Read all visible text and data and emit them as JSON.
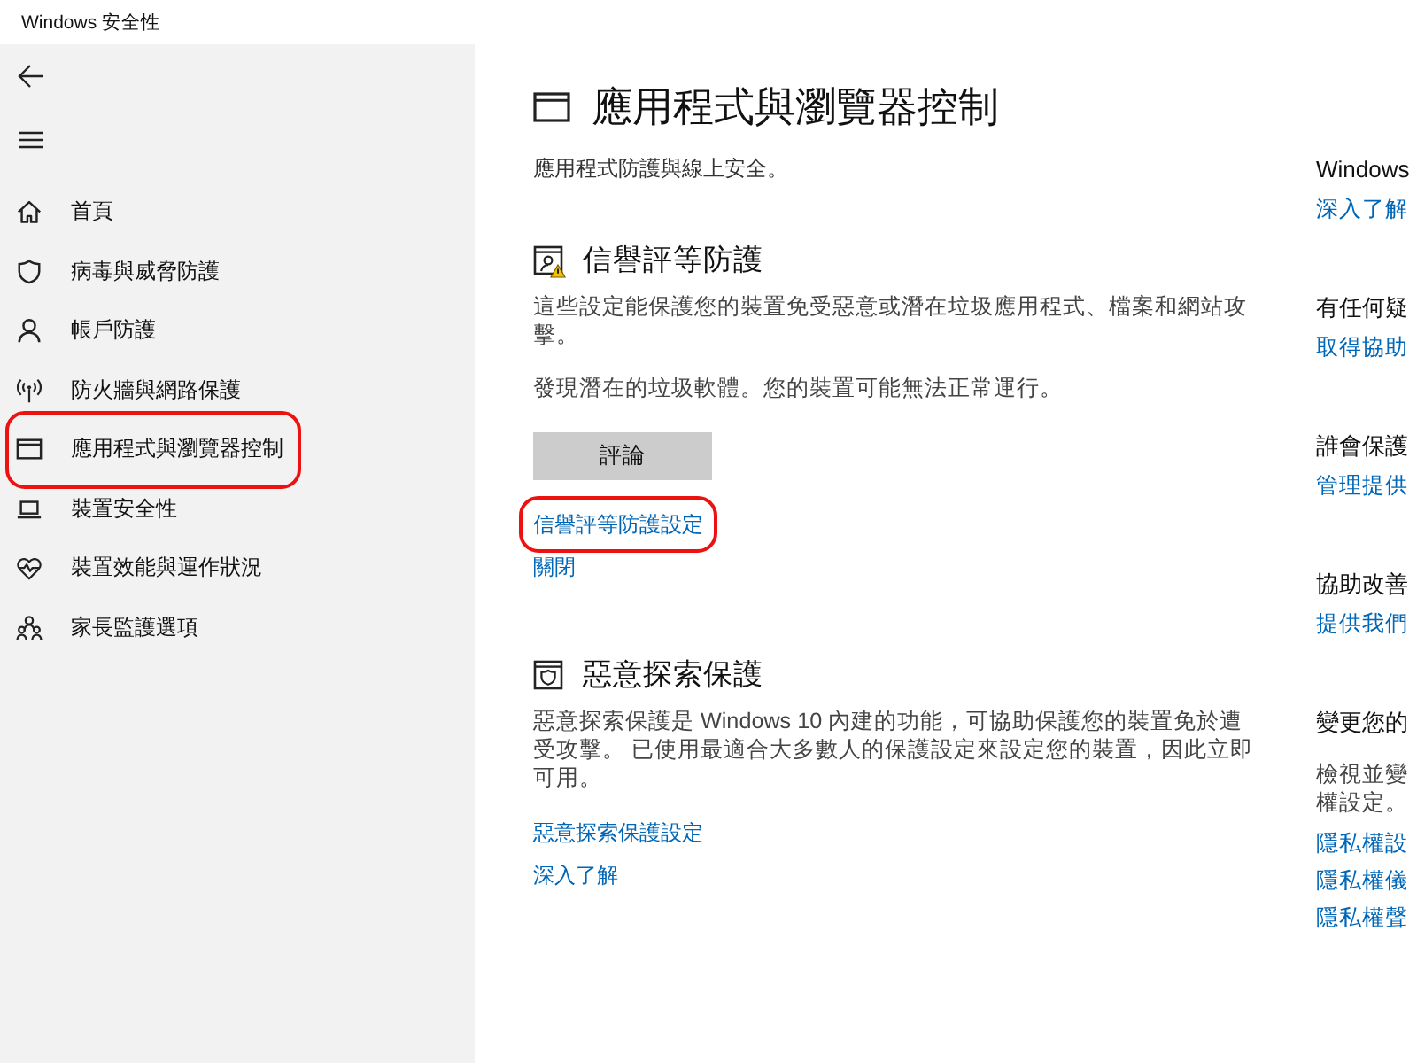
{
  "window": {
    "title": "Windows 安全性"
  },
  "sidebar": {
    "items": [
      {
        "kind": "home",
        "label": "首頁",
        "circled": false
      },
      {
        "kind": "shield",
        "label": "病毒與威脅防護",
        "circled": false
      },
      {
        "kind": "account",
        "label": "帳戶防護",
        "circled": false
      },
      {
        "kind": "network",
        "label": "防火牆與網路保護",
        "circled": false
      },
      {
        "kind": "browser",
        "label": "應用程式與瀏覽器控制",
        "circled": true
      },
      {
        "kind": "device",
        "label": "裝置安全性",
        "circled": false
      },
      {
        "kind": "health",
        "label": "裝置效能與運作狀況",
        "circled": false
      },
      {
        "kind": "family",
        "label": "家長監護選項",
        "circled": false
      }
    ]
  },
  "page": {
    "title": "應用程式與瀏覽器控制",
    "subtitle": "應用程式防護與線上安全。",
    "sections": [
      {
        "kind": "reputation",
        "warning": true,
        "heading": "信譽評等防護",
        "paragraphs": [
          "這些設定能保護您的裝置免受惡意或潛在垃圾應用程式、檔案和網站攻擊。",
          "發現潛在的垃圾軟體。您的裝置可能無法正常運行。"
        ],
        "button": "評論",
        "links": [
          {
            "label": "信譽評等防護設定",
            "circled": true
          },
          {
            "label": "關閉",
            "circled": false
          }
        ]
      },
      {
        "kind": "exploit",
        "warning": false,
        "heading": "惡意探索保護",
        "paragraphs": [
          "惡意探索保護是 Windows 10 內建的功能，可協助保護您的裝置免於遭受攻擊。 已使用最適合大多數人的保護設定來設定您的裝置，因此立即可用。"
        ],
        "links": [
          {
            "label": "惡意探索保護設定",
            "circled": false
          },
          {
            "label": "深入了解",
            "circled": false
          }
        ]
      }
    ]
  },
  "side_panel": {
    "groups": [
      {
        "heading": "Windows",
        "links": [
          "深入了解"
        ]
      },
      {
        "heading": "有任何疑",
        "links": [
          "取得協助"
        ]
      },
      {
        "heading": "誰會保護",
        "links": [
          "管理提供"
        ]
      },
      {
        "heading": "協助改善",
        "links": [
          "提供我們"
        ]
      },
      {
        "heading": "變更您的",
        "text_lines": [
          "檢視並變",
          "權設定。"
        ],
        "links": [
          "隱私權設",
          "隱私權儀",
          "隱私權聲"
        ]
      }
    ]
  }
}
